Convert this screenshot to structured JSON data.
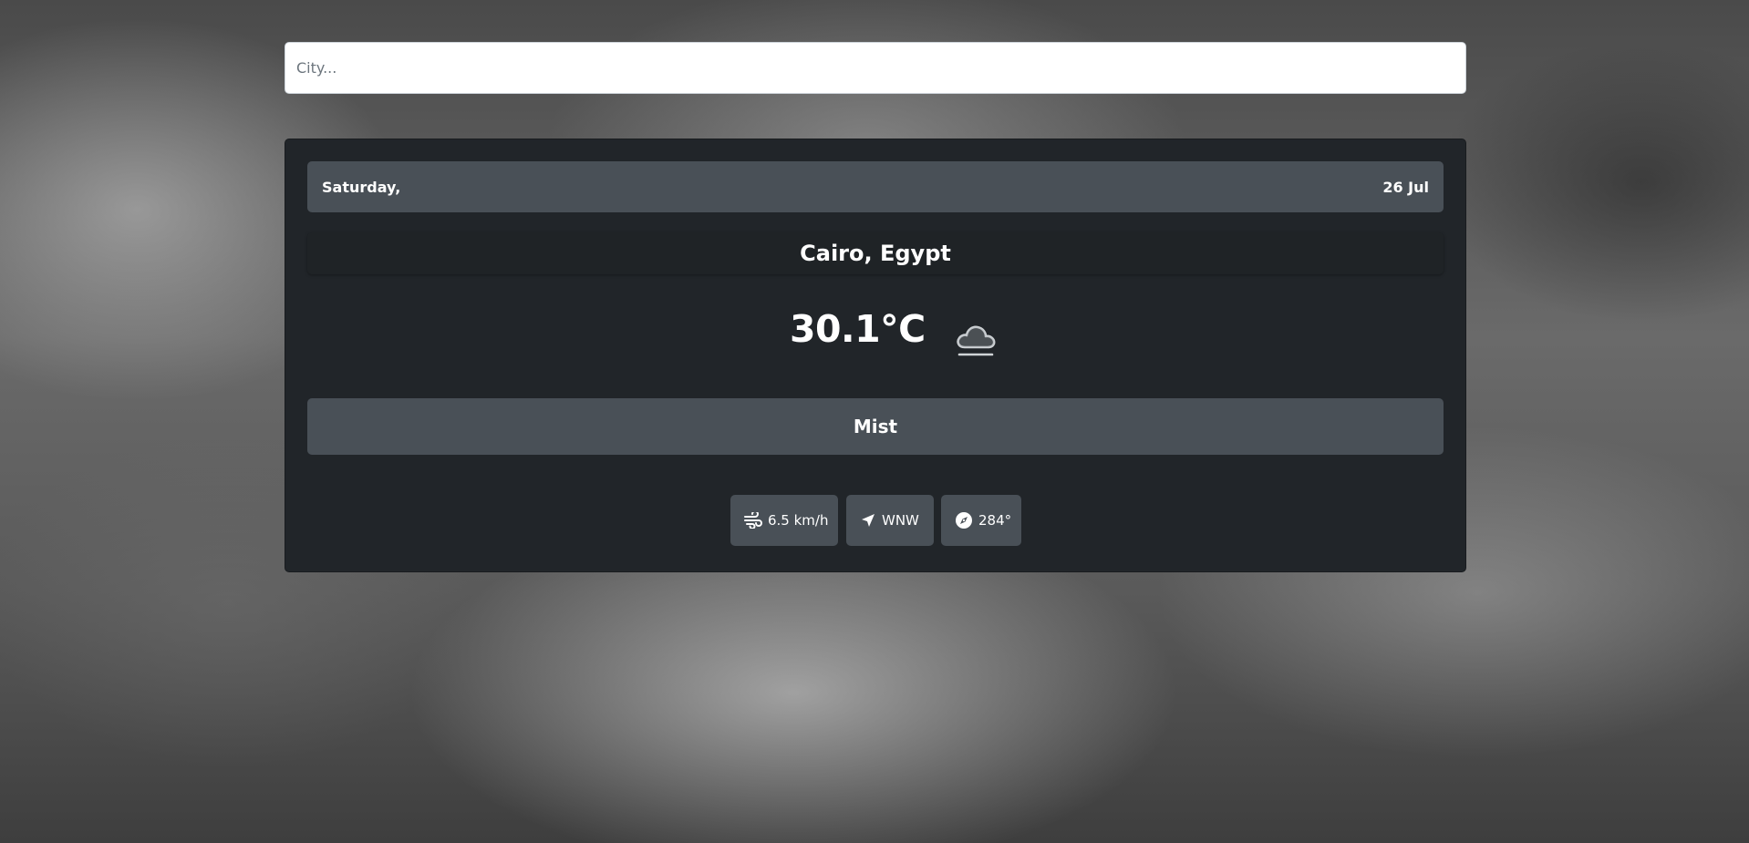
{
  "search": {
    "placeholder": "City..."
  },
  "weather": {
    "day": "Saturday,",
    "date": "26 Jul",
    "location": "Cairo, Egypt",
    "temperature": "30.1°C",
    "condition": "Mist",
    "condition_icon": "mist-cloud-icon",
    "wind_speed": "6.5 km/h",
    "wind_direction": "WNW",
    "wind_degree": "284°"
  },
  "icons": {
    "wind": "wind-icon",
    "direction": "navigation-arrow-icon",
    "degree": "compass-icon"
  },
  "colors": {
    "card_background": "#212529",
    "bar_background": "#495057",
    "text": "#ffffff",
    "input_background": "#ffffff"
  }
}
